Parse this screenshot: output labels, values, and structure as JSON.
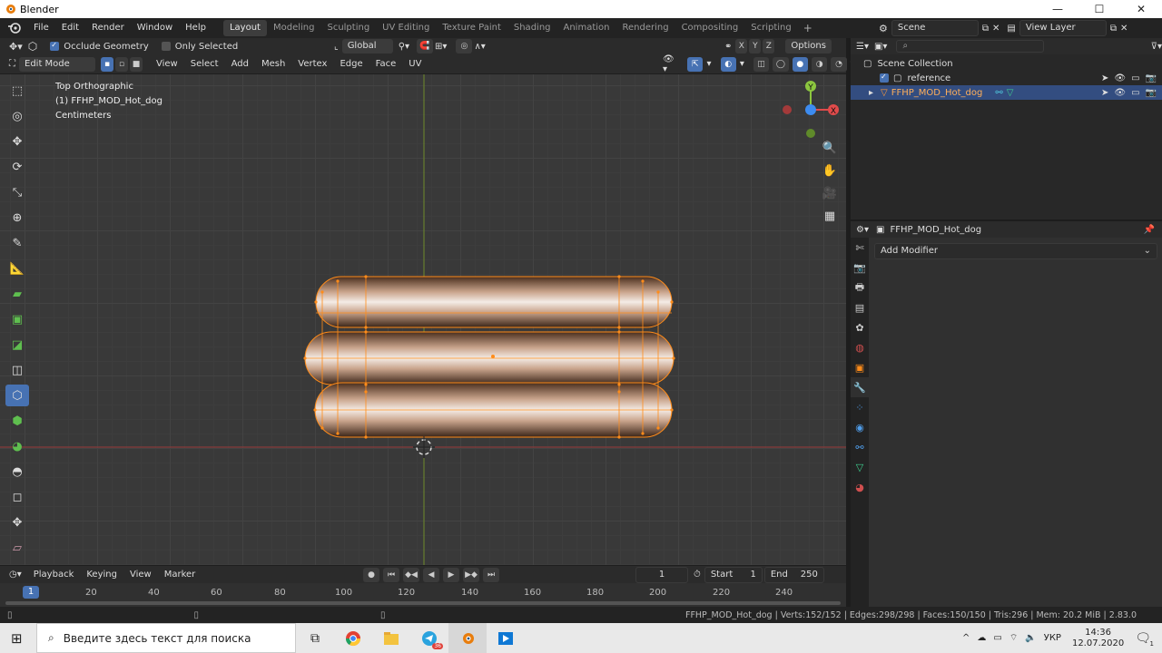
{
  "app": {
    "window_title": "Blender",
    "minimize": "—",
    "maximize": "☐",
    "close": "✕"
  },
  "menu": [
    "File",
    "Edit",
    "Render",
    "Window",
    "Help"
  ],
  "workspaces": [
    "Layout",
    "Modeling",
    "Sculpting",
    "UV Editing",
    "Texture Paint",
    "Shading",
    "Animation",
    "Rendering",
    "Compositing",
    "Scripting"
  ],
  "active_workspace": "Layout",
  "scene": {
    "label": "Scene",
    "view_layer": "View Layer"
  },
  "viewport_header": {
    "occlude_geometry": "Occlude Geometry",
    "only_selected": "Only Selected",
    "transform_orientation": "Global",
    "axes": [
      "X",
      "Y",
      "Z"
    ],
    "options": "Options",
    "mode": "Edit Mode",
    "menus": [
      "View",
      "Select",
      "Add",
      "Mesh",
      "Vertex",
      "Edge",
      "Face",
      "UV"
    ]
  },
  "viewport_info": {
    "view": "Top Orthographic",
    "object": "(1) FFHP_MOD_Hot_dog",
    "units": "Centimeters"
  },
  "gizmo": {
    "y": "Y",
    "x": "X"
  },
  "timeline": {
    "menus": [
      "Playback",
      "Keying",
      "View",
      "Marker"
    ],
    "current_frame": "1",
    "start_label": "Start",
    "start": "1",
    "end_label": "End",
    "end": "250",
    "ruler_current": "1",
    "ruler": [
      "20",
      "40",
      "60",
      "80",
      "100",
      "120",
      "140",
      "160",
      "180",
      "200",
      "220",
      "240"
    ]
  },
  "status": {
    "stats": "FFHP_MOD_Hot_dog | Verts:152/152 | Edges:298/298 | Faces:150/150 | Tris:296 | Mem: 20.2 MiB | 2.83.0"
  },
  "outliner": {
    "collection": "Scene Collection",
    "items": [
      {
        "label": "reference",
        "selected": false
      },
      {
        "label": "FFHP_MOD_Hot_dog",
        "selected": true
      }
    ]
  },
  "properties": {
    "object": "FFHP_MOD_Hot_dog",
    "add_modifier": "Add Modifier"
  },
  "taskbar": {
    "search_placeholder": "Введите здесь текст для поиска",
    "lang": "УКР",
    "time": "14:36",
    "date": "12.07.2020",
    "notification_count": "1",
    "telegram_badge": "36"
  },
  "colors": {
    "accent": "#4772b3",
    "selection": "#ff8c1a",
    "viewport_bg": "#393939"
  }
}
